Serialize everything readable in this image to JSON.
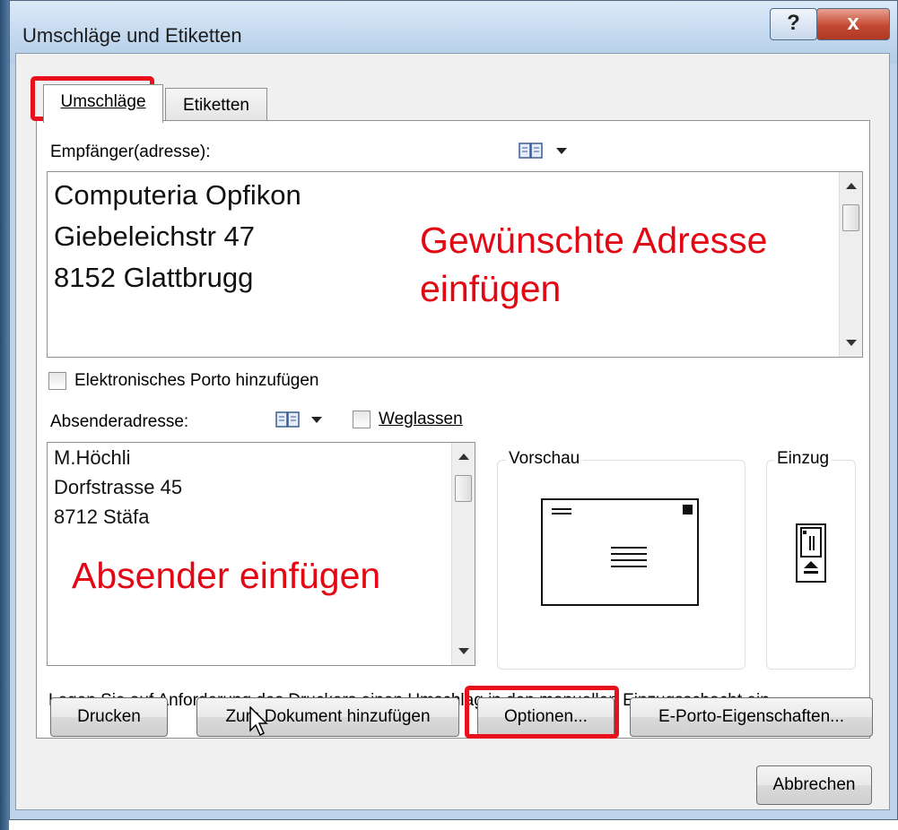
{
  "window": {
    "title": "Umschläge und Etiketten",
    "help_glyph": "?",
    "close_glyph": "x"
  },
  "tabs": [
    {
      "label": "Umschläge",
      "active": true
    },
    {
      "label": "Etiketten",
      "active": false
    }
  ],
  "recipient": {
    "label": "Empfänger(adresse):",
    "lines": [
      "Computeria Opfikon",
      "Giebeleichstr 47",
      "8152 Glattbrugg"
    ]
  },
  "electronic_postage": {
    "label": "Elektronisches Porto hinzufügen",
    "checked": false
  },
  "sender": {
    "label": "Absenderadresse:",
    "omit_label": "Weglassen",
    "omit_checked": false,
    "lines": [
      "M.Höchli",
      "Dorfstrasse 45",
      "8712 Stäfa"
    ]
  },
  "preview": {
    "label": "Vorschau"
  },
  "feed": {
    "label": "Einzug"
  },
  "instruction": "Legen Sie auf Anforderung des Druckers einen Umschlag in den manuellen Einzugsschacht ein.",
  "buttons": {
    "print": "Drucken",
    "add_to_document": "Zum Dokument hinzufügen",
    "options": "Optionen...",
    "epostage_properties": "E-Porto-Eigenschaften...",
    "cancel": "Abbrechen"
  },
  "annotations": {
    "recipient_line1": "Gewünschte Adresse",
    "recipient_line2": "einfügen",
    "sender": "Absender einfügen"
  },
  "colors": {
    "highlight": "#e8101a",
    "annotation_text": "#e30613"
  },
  "icons": [
    "address-book-icon",
    "dropdown-arrow-icon",
    "scroll-up-icon",
    "scroll-down-icon",
    "envelope-preview-icon",
    "envelope-feed-icon",
    "mouse-cursor-icon"
  ]
}
